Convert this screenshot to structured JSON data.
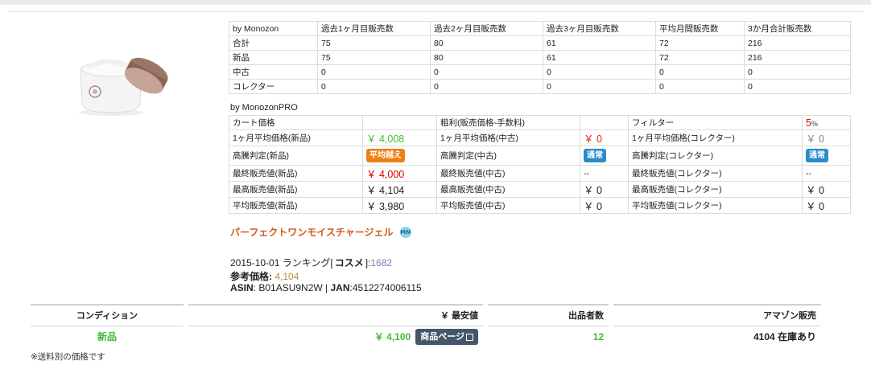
{
  "monozon": {
    "headers": [
      "by Monozon",
      "過去1ヶ月目販売数",
      "過去2ヶ月目販売数",
      "過去3ヶ月目販売数",
      "平均月間販売数",
      "3か月合計販売数"
    ],
    "rows": [
      [
        "合計",
        "75",
        "80",
        "61",
        "72",
        "216"
      ],
      [
        "新品",
        "75",
        "80",
        "61",
        "72",
        "216"
      ],
      [
        "中古",
        "0",
        "0",
        "0",
        "0",
        "0"
      ],
      [
        "コレクター",
        "0",
        "0",
        "0",
        "0",
        "0"
      ]
    ]
  },
  "pro": {
    "label": "by MonozonPRO",
    "cart_label": "カート価格",
    "profit_label": "粗利(販売価格-手数料)",
    "filter_label": "フィルター",
    "filter_value": "5",
    "filter_unit": "%",
    "rows": [
      {
        "l1": "1ヶ月平均価格(新品)",
        "v1": "￥ 4,008",
        "l2": "1ヶ月平均価格(中古)",
        "v2": "￥ 0",
        "l3": "1ヶ月平均価格(コレクター)",
        "v3": "￥ 0"
      },
      {
        "l1": "高騰判定(新品)",
        "v1": "平均越え",
        "l2": "高騰判定(中古)",
        "v2": "通常",
        "l3": "高騰判定(コレクター)",
        "v3": "通常"
      },
      {
        "l1": "最終販売値(新品)",
        "v1": "￥ 4,000",
        "l2": "最終販売値(中古)",
        "v2": "--",
        "l3": "最終販売値(コレクター)",
        "v3": "--"
      },
      {
        "l1": "最高販売値(新品)",
        "v1": "￥ 4,104",
        "l2": "最高販売値(中古)",
        "v2": "￥ 0",
        "l3": "最高販売値(コレクター)",
        "v3": "￥ 0"
      },
      {
        "l1": "平均販売値(新品)",
        "v1": "￥ 3,980",
        "l2": "平均販売値(中古)",
        "v2": "￥ 0",
        "l3": "平均販売値(コレクター)",
        "v3": "￥ 0"
      }
    ]
  },
  "product": {
    "title": "パーフェクトワンモイスチャージェル",
    "mn_icon": "MN",
    "ranking_date": "2015-10-01 ランキング[",
    "ranking_category": "コスメ",
    "ranking_close": "]:",
    "ranking_value": "1682",
    "ref_price_label": "参考価格:",
    "ref_price": "4,104",
    "asin_label": "ASIN",
    "asin": ": B01ASU9N2W | ",
    "jan_label": "JAN",
    "jan": ":4512274006115"
  },
  "offers": {
    "condition_header": "コンディション",
    "price_header": "￥ 最安値",
    "sellers_header": "出品者数",
    "amazon_header": "アマゾン販売",
    "condition": "新品",
    "price": "￥ 4,100",
    "product_page_button": "商品ページ",
    "sellers": "12",
    "amazon_stock": "4104 在庫あり"
  },
  "footnote": "※送料別の価格です",
  "colors": {
    "green": "#44bb33",
    "red": "#dd0000",
    "orange_badge": "#f07f12",
    "blue_badge": "#2a8bc9",
    "title": "#d25a1a"
  },
  "icons": {
    "product": "product-image",
    "monozon": "mn-icon",
    "external": "external-link-icon"
  }
}
